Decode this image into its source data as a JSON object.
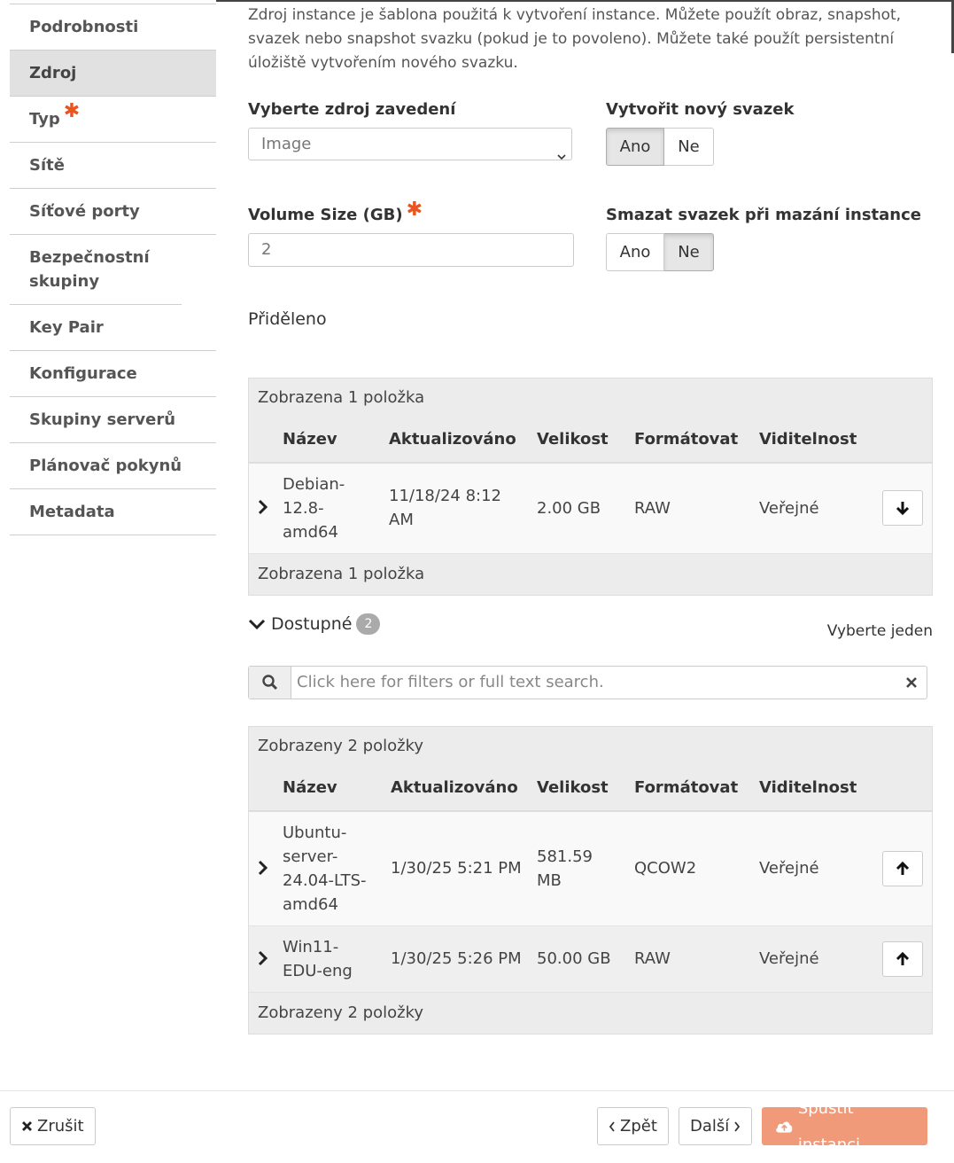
{
  "sidebar": {
    "items": [
      {
        "label": "Podrobnosti",
        "required": false
      },
      {
        "label": "Zdroj",
        "required": false
      },
      {
        "label": "Typ",
        "required": true
      },
      {
        "label": "Sítě",
        "required": false
      },
      {
        "label": "Síťové porty",
        "required": false
      },
      {
        "label": "Bezpečnostní skupiny",
        "required": false
      },
      {
        "label": "Key Pair",
        "required": false
      },
      {
        "label": "Konfigurace",
        "required": false
      },
      {
        "label": "Skupiny serverů",
        "required": false
      },
      {
        "label": "Plánovač pokynů",
        "required": false
      },
      {
        "label": "Metadata",
        "required": false
      }
    ],
    "active": "Zdroj",
    "required_mark": "✱"
  },
  "intro": "Zdroj instance je šablona použitá k vytvoření instance. Můžete použít obraz, snapshot, svazek nebo snapshot svazku (pokud je to povoleno). Můžete také použít persistentní úložiště vytvořením nového svazku.",
  "form": {
    "boot_source_label": "Vyberte zdroj zavedení",
    "boot_source_value": "Image",
    "create_volume_label": "Vytvořit nový svazek",
    "volume_size_label": "Volume Size (GB)",
    "volume_size_value": "2",
    "delete_volume_label": "Smazat svazek při mazání instance",
    "yes": "Ano",
    "no": "Ne",
    "create_volume_selected": "Ano",
    "delete_volume_selected": "Ne"
  },
  "allocated": {
    "title": "Přiděleno",
    "caption": "Zobrazena 1 položka",
    "footer": "Zobrazena 1 položka",
    "columns": [
      "Název",
      "Aktualizováno",
      "Velikost",
      "Formátovat",
      "Viditelnost"
    ],
    "rows": [
      {
        "name": "Debian-12.8-amd64",
        "updated": "11/18/24 8:12 AM",
        "size": "2.00 GB",
        "format": "RAW",
        "visibility": "Veřejné"
      }
    ]
  },
  "available": {
    "title": "Dostupné",
    "count": "2",
    "pick_one": "Vyberte jeden",
    "search_placeholder": "Click here for filters or full text search.",
    "caption": "Zobrazeny 2 položky",
    "footer": "Zobrazeny 2 položky",
    "columns": [
      "Název",
      "Aktualizováno",
      "Velikost",
      "Formátovat",
      "Viditelnost"
    ],
    "rows": [
      {
        "name": "Ubuntu-server-24.04-LTS-amd64",
        "updated": "1/30/25 5:21 PM",
        "size": "581.59 MB",
        "format": "QCOW2",
        "visibility": "Veřejné"
      },
      {
        "name": "Win11-EDU-eng",
        "updated": "1/30/25 5:26 PM",
        "size": "50.00 GB",
        "format": "RAW",
        "visibility": "Veřejné"
      }
    ]
  },
  "footer": {
    "cancel": "Zrušit",
    "back": "Zpět",
    "next": "Další",
    "launch": "Spustit instanci"
  },
  "colors": {
    "accent": "#e95420",
    "launch_button": "#f09a7a"
  }
}
